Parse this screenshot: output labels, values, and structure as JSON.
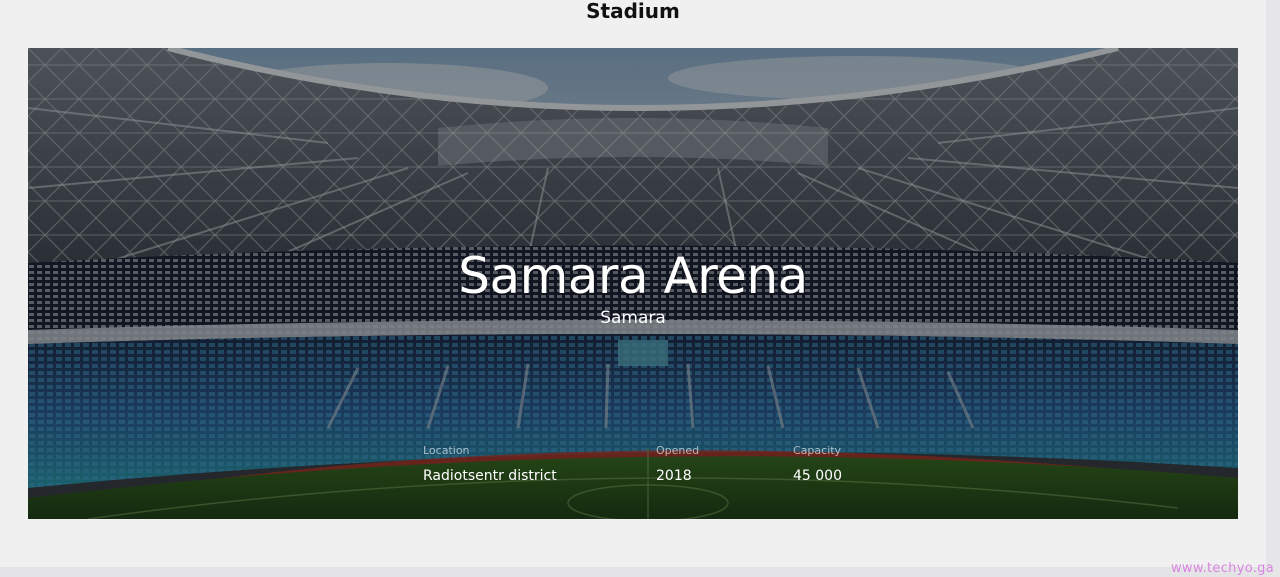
{
  "page": {
    "title": "Stadium"
  },
  "hero": {
    "name": "Samara Arena",
    "city": "Samara",
    "image_subject": "stadium-interior-photo"
  },
  "facts": [
    {
      "label": "Location",
      "value": "Radiotsentr district"
    },
    {
      "label": "Opened",
      "value": "2018"
    },
    {
      "label": "Capacity",
      "value": "45 000"
    }
  ],
  "watermark": "www.techyo.ga",
  "colors": {
    "page_background": "#f0f0f1",
    "seats_blue": "#2b6aa8",
    "seats_teal": "#2a9db0",
    "pitch_green": "#2f5a1c",
    "roof_steel": "#c9cfd4",
    "watermark": "#d985e0"
  }
}
